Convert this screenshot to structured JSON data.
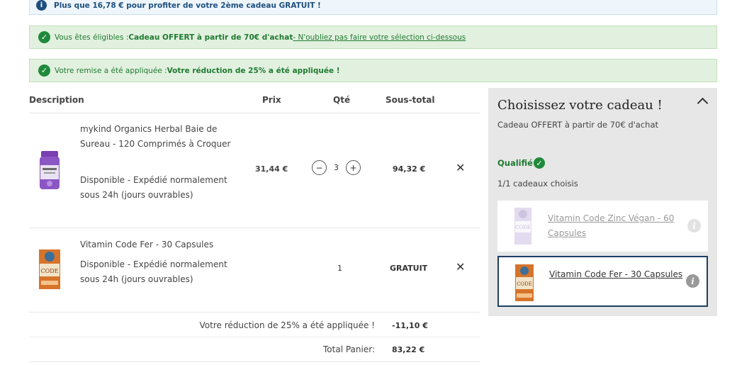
{
  "banners": {
    "info": "Plus que 16,78 € pour profiter de votre 2ème cadeau GRATUIT !",
    "eligible_prefix": "Vous êtes éligibles : ",
    "eligible_bold": "Cadeau OFFERT à partir de 70€ d'achat",
    "eligible_link": " - N'oubliez pas faire votre sélection ci-dessous",
    "discount_prefix": "Votre remise a été appliquée : ",
    "discount_bold": "Votre réduction de 25% a été appliquée !"
  },
  "table": {
    "headers": {
      "description": "Description",
      "price": "Prix",
      "qty": "Qté",
      "subtotal": "Sous-total"
    },
    "rows": [
      {
        "name": "mykind Organics Herbal Baie de Sureau - 120 Comprimés à Croquer",
        "availability": "Disponible - Expédié normalement sous 24h (jours ouvrables)",
        "price": "31,44 €",
        "qty": "3",
        "subtotal": "94,32 €"
      },
      {
        "name": "Vitamin Code Fer - 30 Capsules",
        "availability": "Disponible - Expédié normalement sous 24h (jours ouvrables)",
        "price": "",
        "qty": "1",
        "subtotal": "GRATUIT"
      }
    ]
  },
  "totals": {
    "discount_label": "Votre réduction de 25% a été appliquée !",
    "discount_value": "-11,10 €",
    "total_label": "Total Panier:",
    "total_value": "83,22 €"
  },
  "gift_panel": {
    "title": "Choisissez votre cadeau !",
    "subtitle": "Cadeau OFFERT à partir de 70€ d'achat",
    "status": "Qualifié",
    "count": "1/1 cadeaux choisis",
    "gifts": [
      {
        "name": "Vitamin Code Zinc Végan - 60 Capsules",
        "selected": false
      },
      {
        "name": "Vitamin Code Fer - 30 Capsules",
        "selected": true
      }
    ]
  },
  "icons": {
    "remove": "✕",
    "minus": "−",
    "plus": "+",
    "info": "i",
    "check": "✓"
  },
  "colors": {
    "success": "#1f8a3a",
    "info_bg": "#eef6fc",
    "success_bg": "#e2f1df",
    "panel_bg": "#e7e7e7",
    "selected_border": "#1d3f63"
  }
}
